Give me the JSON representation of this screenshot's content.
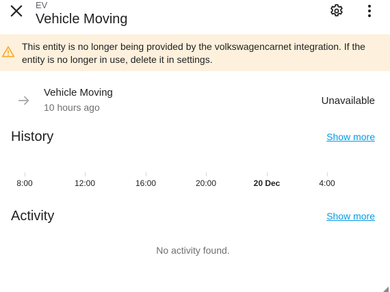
{
  "header": {
    "breadcrumb": "EV",
    "title": "Vehicle Moving"
  },
  "warning": {
    "text": "This entity is no longer being provided by the volkswagencarnet integration. If the entity is no longer in use, delete it in settings.",
    "color": "#f9a825",
    "background": "#fdf1dd"
  },
  "entity": {
    "name": "Vehicle Moving",
    "last_changed": "10 hours ago",
    "state": "Unavailable",
    "icon": "arrow-right-icon"
  },
  "history": {
    "title": "History",
    "show_more": "Show more",
    "axis_labels": [
      "8:00",
      "12:00",
      "16:00",
      "20:00",
      "20 Dec",
      "4:00"
    ]
  },
  "activity": {
    "title": "Activity",
    "show_more": "Show more",
    "empty_text": "No activity found."
  },
  "colors": {
    "link": "#039be5",
    "secondary_text": "#6f6f6f"
  }
}
